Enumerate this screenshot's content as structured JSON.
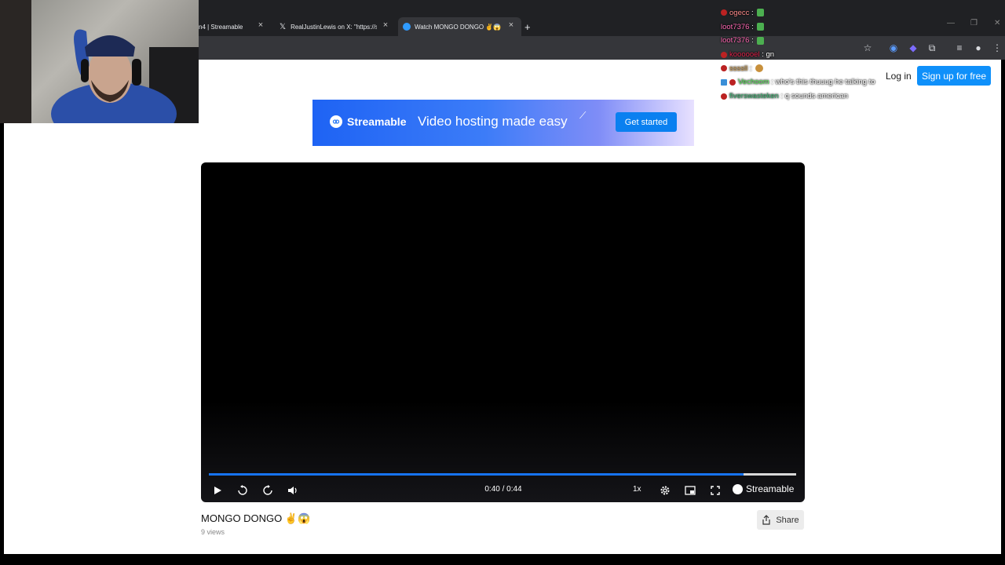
{
  "browser": {
    "tabs": [
      {
        "label": "n4 | Streamable"
      },
      {
        "label": "RealJustinLewis on X: \"https://s"
      },
      {
        "label": "Watch MONGO DONGO ✌️😱"
      }
    ],
    "new_tab": "+"
  },
  "header": {
    "login": "Log in",
    "signup": "Sign up for free"
  },
  "ad": {
    "logo_text": "Streamable",
    "headline": "Video hosting made easy",
    "cta": "Get started"
  },
  "player": {
    "time": "0:40 / 0:44",
    "progress": 0.91,
    "speed": "1x",
    "brand": "Streamable"
  },
  "video": {
    "title": "MONGO DONGO ✌️😱",
    "views": "9 views",
    "share_label": "Share"
  },
  "chat": [
    {
      "user": "ogecc",
      "text": "",
      "color": "#ff8c8c",
      "emote": "green"
    },
    {
      "user": "loot7376",
      "text": "",
      "color": "#ff69b4",
      "emote": "green"
    },
    {
      "user": "loot7376",
      "text": "",
      "color": "#ff69b4",
      "emote": "green"
    },
    {
      "user": "koooooel",
      "text": "gn",
      "color": "#e0204a",
      "emote": ""
    },
    {
      "user": "ssssll",
      "text": "",
      "color": "#d4a050",
      "emote": "face"
    },
    {
      "user": "Vechoom",
      "text": "who's this thuuug he talking to",
      "color": "#5ce65c",
      "emote": ""
    },
    {
      "user": "fiverswasteken",
      "text": "q sounds american",
      "color": "#3cb371",
      "emote": ""
    }
  ]
}
